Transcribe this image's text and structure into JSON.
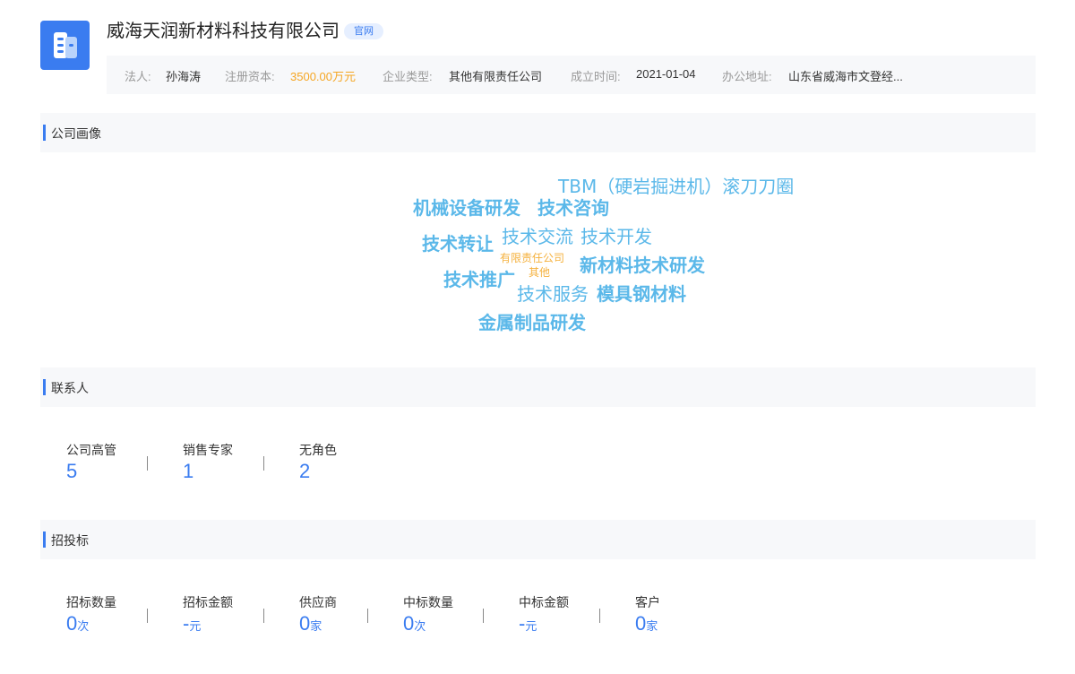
{
  "company": {
    "name": "威海天润新材料科技有限公司",
    "badge": "官网",
    "logo_color": "#3a7cf0",
    "logo_icon": "building-icon"
  },
  "info": {
    "legal_rep_label": "法人:",
    "legal_rep": "孙海涛",
    "capital_label": "注册资本:",
    "capital": "3500.00万元",
    "type_label": "企业类型:",
    "type": "其他有限责任公司",
    "founded_label": "成立时间:",
    "founded": "2021-01-04",
    "address_label": "办公地址:",
    "address": "山东省威海市文登经..."
  },
  "portrait": {
    "title": "公司画像",
    "words": [
      "TBM（硬岩掘进机）滚刀刀圈",
      "机械设备研发",
      "技术咨询",
      "技术转让",
      "技术交流",
      "技术开发",
      "有限责任公司",
      "其他",
      "新材料技术研发",
      "技术推广",
      "技术服务",
      "模具钢材料",
      "金属制品研发"
    ],
    "colors": {
      "primary": "#5bb8e9",
      "secondary": "#f5b13d"
    }
  },
  "contacts": {
    "title": "联系人",
    "stats": [
      {
        "label": "公司高管",
        "value": "5"
      },
      {
        "label": "销售专家",
        "value": "1"
      },
      {
        "label": "无角色",
        "value": "2"
      }
    ]
  },
  "bidding": {
    "title": "招投标",
    "stats": [
      {
        "label": "招标数量",
        "value": "0",
        "unit": "次"
      },
      {
        "label": "招标金额",
        "value": "-",
        "unit": "元"
      },
      {
        "label": "供应商",
        "value": "0",
        "unit": "家"
      },
      {
        "label": "中标数量",
        "value": "0",
        "unit": "次"
      },
      {
        "label": "中标金额",
        "value": "-",
        "unit": "元"
      },
      {
        "label": "客户",
        "value": "0",
        "unit": "家"
      }
    ]
  }
}
